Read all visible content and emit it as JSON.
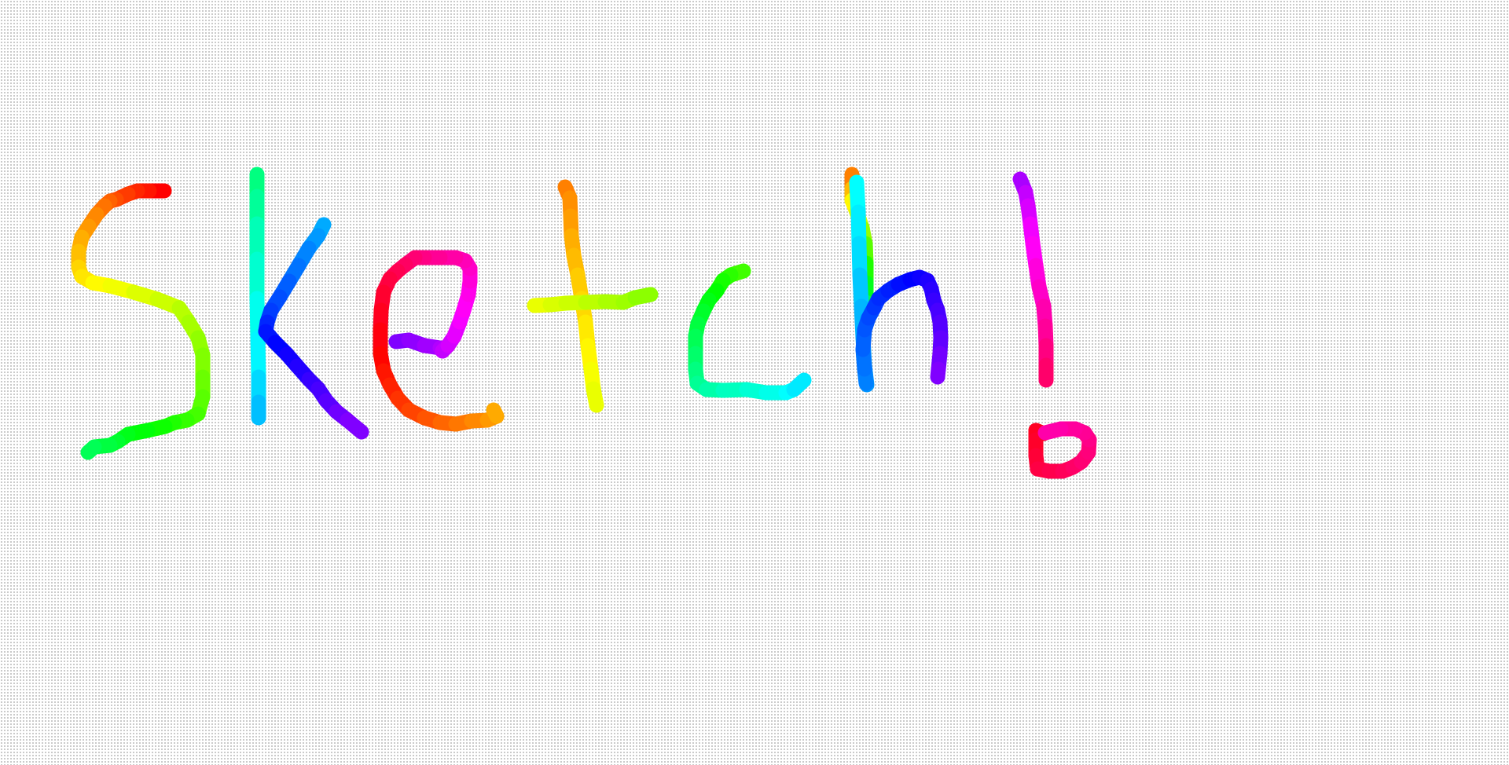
{
  "canvas": {
    "tool": "brush",
    "brush_style": "rainbow",
    "background": "dot-grid",
    "drawing": {
      "handwritten_text": "Sketch!",
      "palette": [
        "#ff0000",
        "#ff7f00",
        "#ffff00",
        "#7fff00",
        "#00ff00",
        "#00ff7f",
        "#00ffff",
        "#007fff",
        "#0000ff",
        "#7f00ff",
        "#ff00ff",
        "#ff007f"
      ]
    }
  }
}
